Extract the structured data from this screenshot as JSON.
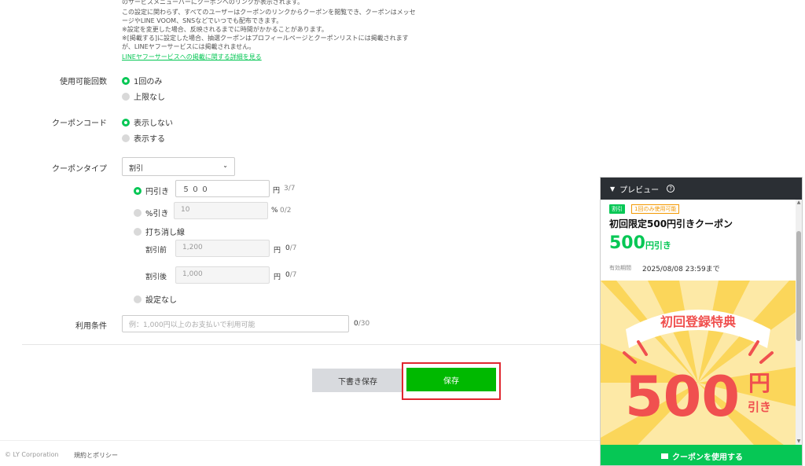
{
  "notes": {
    "line1": "のサービスメニューバーにクーポンへのリンクが表示されます。",
    "line2": "この設定に関わらず、すべてのユーザーはクーポンのリンクからクーポンを閲覧でき、クーポンはメッセ",
    "line3": "ージやLINE VOOM、SNSなどでいつでも配布できます。",
    "line4": "※設定を変更した場合、反映されるまでに時間がかかることがあります。",
    "line5": "※[掲載する]に設定した場合、抽選クーポンはプロフィールページとクーポンリストには掲載されます",
    "line6": "が、LINEヤフーサービスには掲載されません。",
    "link": "LINEヤフーサービスへの掲載に関する詳細を見る"
  },
  "usage": {
    "label": "使用可能回数",
    "options": [
      "1回のみ",
      "上限なし"
    ]
  },
  "code": {
    "label": "クーポンコード",
    "options": [
      "表示しない",
      "表示する"
    ]
  },
  "type": {
    "label": "クーポンタイプ",
    "selected": "割引",
    "options": {
      "yen": "円引き",
      "percent": "%引き",
      "strike": "打ち消し線",
      "none": "設定なし"
    },
    "yen_value": "５００",
    "yen_unit": "円",
    "yen_count": "3/7",
    "percent_placeholder": "10",
    "percent_unit": "%",
    "percent_count": "0/2",
    "before_label": "割引前",
    "before_placeholder": "1,200",
    "before_unit": "円",
    "before_count_num": "0",
    "before_count_max": "/7",
    "after_label": "割引後",
    "after_placeholder": "1,000",
    "after_unit": "円",
    "after_count_num": "0",
    "after_count_max": "/7"
  },
  "terms": {
    "label": "利用条件",
    "placeholder": "例：1,000円以上のお支払いで利用可能",
    "count_num": "0",
    "count_max": "/30"
  },
  "buttons": {
    "draft": "下書き保存",
    "save": "保存"
  },
  "footer": {
    "copyright": "© LY Corporation",
    "policy": "規約とポリシー"
  },
  "preview": {
    "header": "プレビュー",
    "badge_discount": "割引",
    "badge_once": "1回のみ使用可能",
    "title": "初回限定500円引きクーポン",
    "amount": "500",
    "amount_unit": "円引き",
    "valid_label": "有効期間",
    "valid_date": "2025/08/08 23:59まで",
    "banner_heading": "初回登録特典",
    "banner_amount": "500",
    "banner_unit": "円",
    "banner_suffix": "引き",
    "cta": "クーポンを使用する"
  },
  "colors": {
    "accent": "#06c755",
    "save_button": "#00b900",
    "highlight": "#e0262f",
    "banner_bg": "#fde9a6",
    "banner_text": "#f0504f"
  }
}
